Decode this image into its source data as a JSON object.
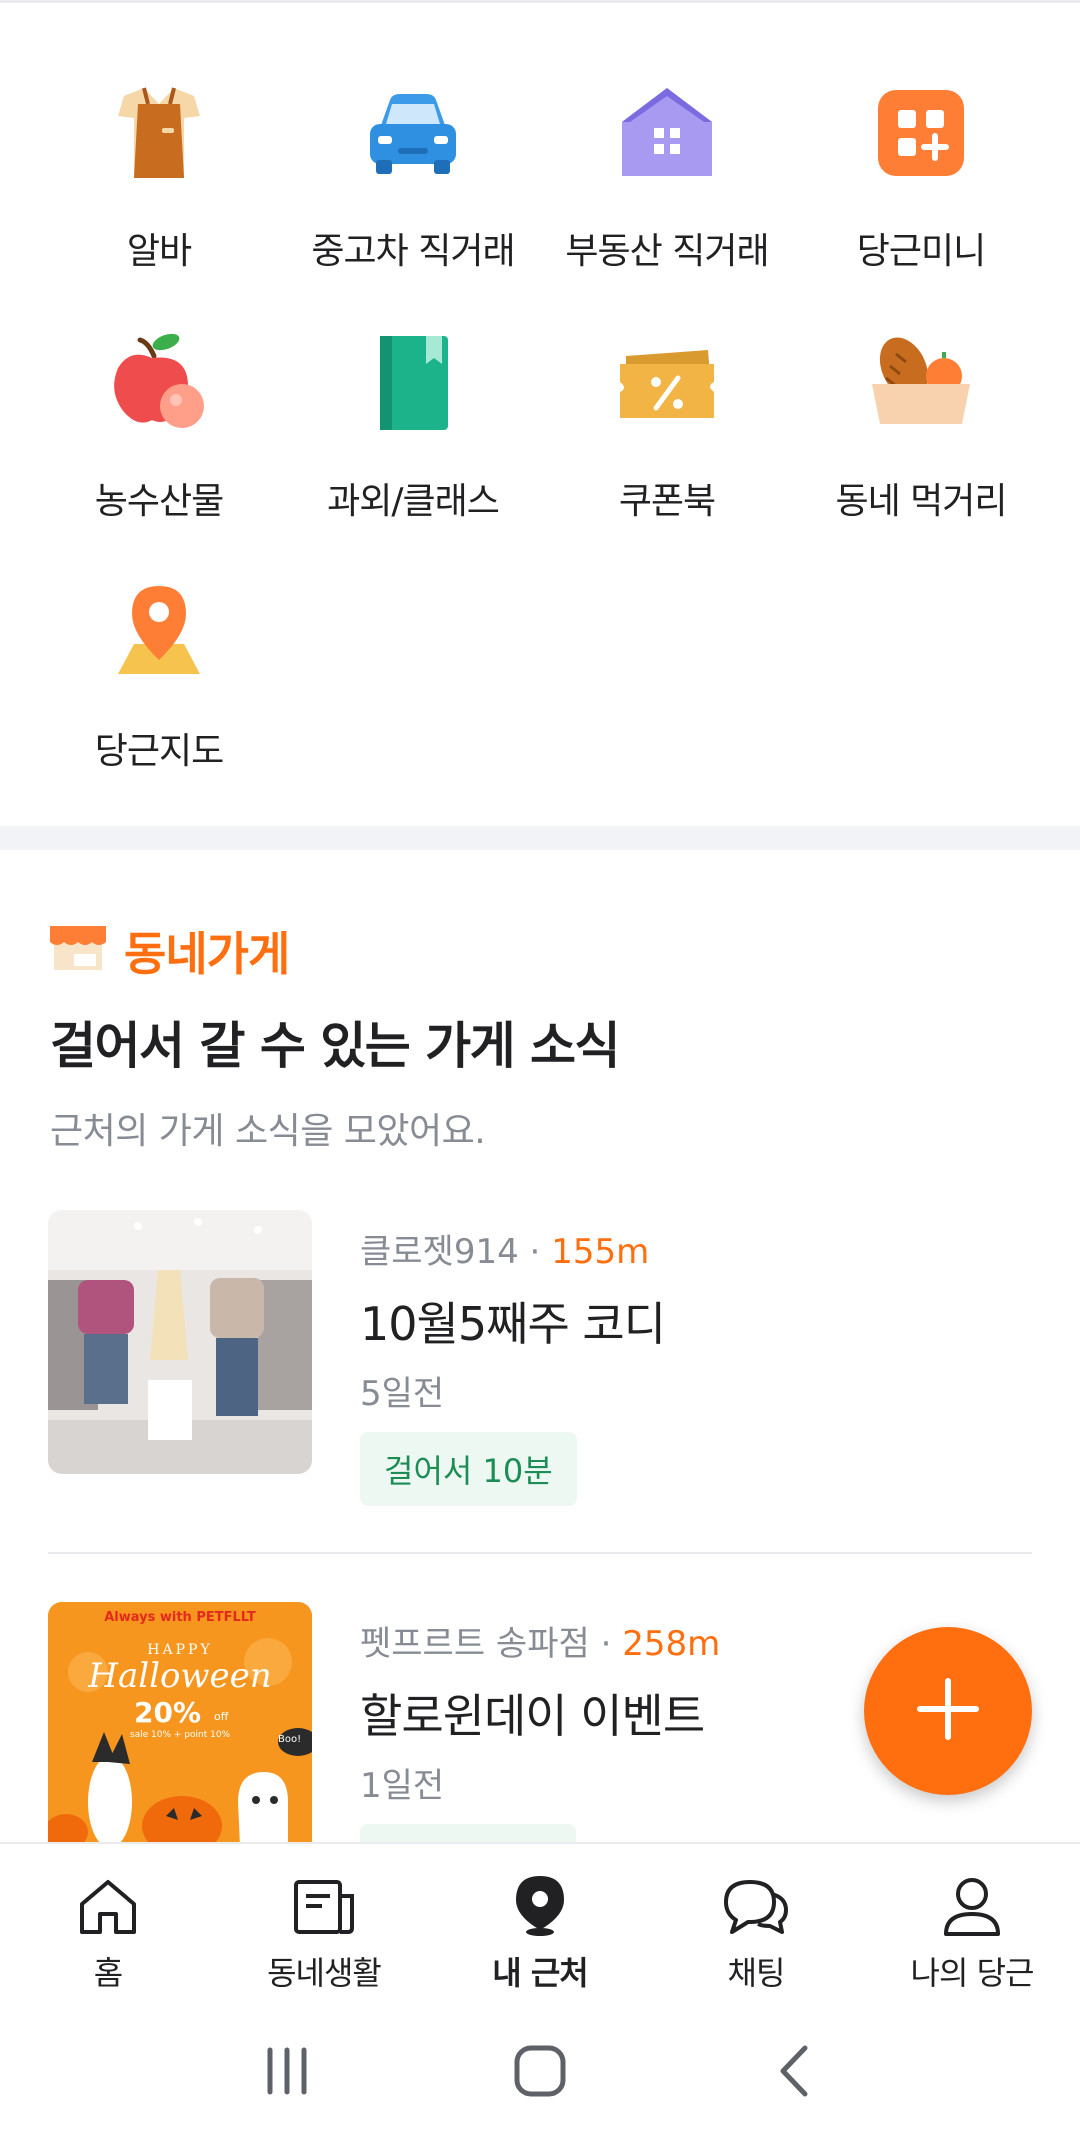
{
  "services": [
    {
      "label": "알바",
      "icon": "apron-icon"
    },
    {
      "label": "중고차 직거래",
      "icon": "car-icon"
    },
    {
      "label": "부동산 직거래",
      "icon": "house-icon"
    },
    {
      "label": "당근미니",
      "icon": "mini-app-icon"
    },
    {
      "label": "농수산물",
      "icon": "apple-icon"
    },
    {
      "label": "과외/클래스",
      "icon": "book-icon"
    },
    {
      "label": "쿠폰북",
      "icon": "coupon-icon"
    },
    {
      "label": "동네 먹거리",
      "icon": "food-basket-icon"
    },
    {
      "label": "당근지도",
      "icon": "map-pin-icon"
    }
  ],
  "store_section": {
    "tag": "동네가게",
    "title": "걸어서 갈 수 있는 가게 소식",
    "subtitle": "근처의 가게 소식을 모았어요."
  },
  "posts": [
    {
      "store": "클로젯914",
      "separator": " · ",
      "distance": "155m",
      "title": "10월5째주 코디",
      "ago": "5일전",
      "walk": "걸어서 10분",
      "thumb": "clothing-store-photo"
    },
    {
      "store": "펫프르트 송파점",
      "separator": " · ",
      "distance": "258m",
      "title": "할로윈데이 이벤트",
      "ago": "1일전",
      "thumb": "halloween-poster",
      "poster": {
        "top": "Always with PETFLLT",
        "happy": "HAPPY",
        "halloween": "Halloween",
        "discount": "20%",
        "off": "off",
        "fine": "sale 10% + point 10%",
        "boo": "Boo!"
      }
    }
  ],
  "tabs": [
    {
      "label": "홈",
      "icon": "home-icon"
    },
    {
      "label": "동네생활",
      "icon": "neighborhood-news-icon"
    },
    {
      "label": "내 근처",
      "icon": "location-pin-icon",
      "active": true
    },
    {
      "label": "채팅",
      "icon": "chat-bubbles-icon"
    },
    {
      "label": "나의 당근",
      "icon": "profile-icon"
    }
  ],
  "colors": {
    "accent": "#ff6f0f",
    "text": "#212124",
    "muted": "#868b94",
    "walk_bg": "#eef8f3",
    "walk_text": "#1d8d56"
  }
}
